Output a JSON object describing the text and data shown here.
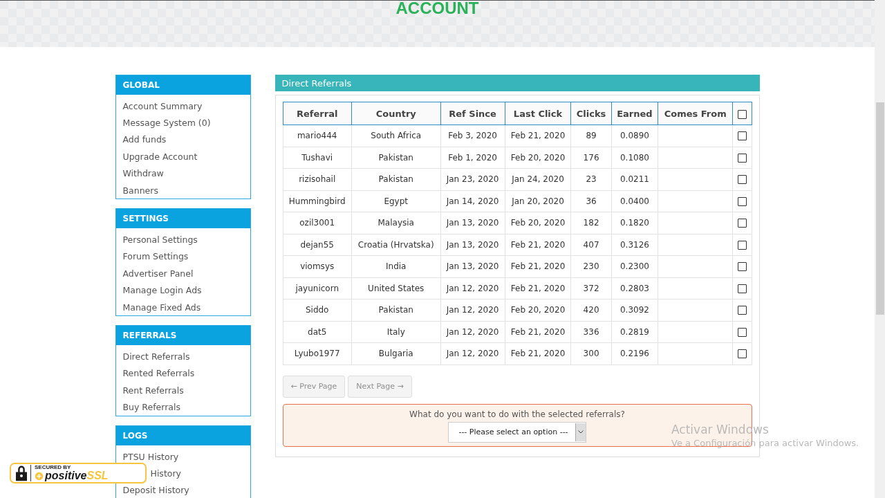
{
  "header": {
    "title": "ACCOUNT"
  },
  "sidebar": [
    {
      "title": "GLOBAL",
      "items": [
        {
          "label": "Account Summary"
        },
        {
          "label": "Message System (0)"
        },
        {
          "label": "Add funds"
        },
        {
          "label": "Upgrade Account"
        },
        {
          "label": "Withdraw"
        },
        {
          "label": "Banners"
        }
      ]
    },
    {
      "title": "SETTINGS",
      "items": [
        {
          "label": "Personal Settings"
        },
        {
          "label": "Forum Settings"
        },
        {
          "label": "Advertiser Panel"
        },
        {
          "label": "Manage Login Ads"
        },
        {
          "label": "Manage Fixed Ads"
        }
      ]
    },
    {
      "title": "REFERRALS",
      "items": [
        {
          "label": "Direct Referrals"
        },
        {
          "label": "Rented Referrals"
        },
        {
          "label": "Rent Referrals"
        },
        {
          "label": "Buy Referrals"
        }
      ]
    },
    {
      "title": "LOGS",
      "items": [
        {
          "label": "PTSU History"
        },
        {
          "label": "History",
          "obscured": true
        },
        {
          "label": "Deposit History"
        }
      ]
    }
  ],
  "panel": {
    "title": "Direct Referrals",
    "columns": [
      "Referral",
      "Country",
      "Ref Since",
      "Last Click",
      "Clicks",
      "Earned",
      "Comes From"
    ],
    "select_all": {
      "checked": false
    },
    "rows": [
      {
        "cells": [
          "mario444",
          "South Africa",
          "Feb 3, 2020",
          "Feb 21, 2020",
          "89",
          "0.0890"
        ],
        "checked": false
      },
      {
        "cells": [
          "Tushavi",
          "Pakistan",
          "Feb 1, 2020",
          "Feb 20, 2020",
          "176",
          "0.1080"
        ],
        "checked": false
      },
      {
        "cells": [
          "rizisohail",
          "Pakistan",
          "Jan 23, 2020",
          "Jan 24, 2020",
          "23",
          "0.0211"
        ],
        "checked": false
      },
      {
        "cells": [
          "Hummingbird",
          "Egypt",
          "Jan 14, 2020",
          "Jan 20, 2020",
          "36",
          "0.0400"
        ],
        "checked": false
      },
      {
        "cells": [
          "ozil3001",
          "Malaysia",
          "Jan 13, 2020",
          "Feb 20, 2020",
          "182",
          "0.1820"
        ],
        "checked": false
      },
      {
        "cells": [
          "dejan55",
          "Croatia (Hrvatska)",
          "Jan 13, 2020",
          "Feb 21, 2020",
          "407",
          "0.3126"
        ],
        "checked": false
      },
      {
        "cells": [
          "viomsys",
          "India",
          "Jan 13, 2020",
          "Feb 21, 2020",
          "230",
          "0.2300"
        ],
        "checked": false
      },
      {
        "cells": [
          "jayunicorn",
          "United States",
          "Jan 12, 2020",
          "Feb 21, 2020",
          "372",
          "0.2803"
        ],
        "checked": false
      },
      {
        "cells": [
          "Siddo",
          "Pakistan",
          "Jan 12, 2020",
          "Feb 20, 2020",
          "420",
          "0.3092"
        ],
        "checked": false
      },
      {
        "cells": [
          "dat5",
          "Italy",
          "Jan 12, 2020",
          "Feb 21, 2020",
          "336",
          "0.2819"
        ],
        "checked": false
      },
      {
        "cells": [
          "Lyubo1977",
          "Bulgaria",
          "Jan 12, 2020",
          "Feb 21, 2020",
          "300",
          "0.2196"
        ],
        "checked": false
      }
    ],
    "pager": [
      {
        "label": "← Prev Page",
        "disabled": true
      },
      {
        "label": "Next Page →",
        "disabled": true
      }
    ],
    "action": {
      "question": "What do you want to do with the selected referrals?",
      "select": "--- Please select an option ---"
    }
  },
  "ssl_badge": {
    "top": "SECURED BY",
    "brand": "positive",
    "brand_accent": "SSL"
  },
  "windows_notice": {
    "title": "Activar Windows",
    "subtitle": "Ve a Configuración para activar Windows."
  }
}
